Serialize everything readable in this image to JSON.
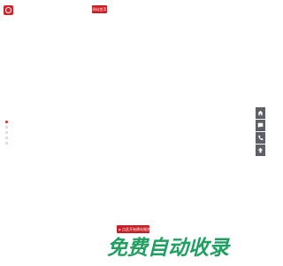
{
  "header": {
    "logo_icon": "brand-logo-icon",
    "top_button_label": "网站首页"
  },
  "carousel": {
    "dot_count": 5,
    "active_index": 0,
    "accent_color": "#e0262d"
  },
  "side_tools": {
    "items": [
      {
        "icon": "home-icon"
      },
      {
        "icon": "chat-icon"
      },
      {
        "icon": "phone-icon"
      },
      {
        "icon": "arrow-up-icon"
      }
    ],
    "color": "#5d6166"
  },
  "footer": {
    "bottom_button_label": "点此开始建站服务",
    "bottom_button_icon": "flag-icon",
    "watermark_text": "免费自动收录"
  },
  "colors": {
    "brand_red": "#c81e24",
    "watermark_green": "#20a060"
  }
}
